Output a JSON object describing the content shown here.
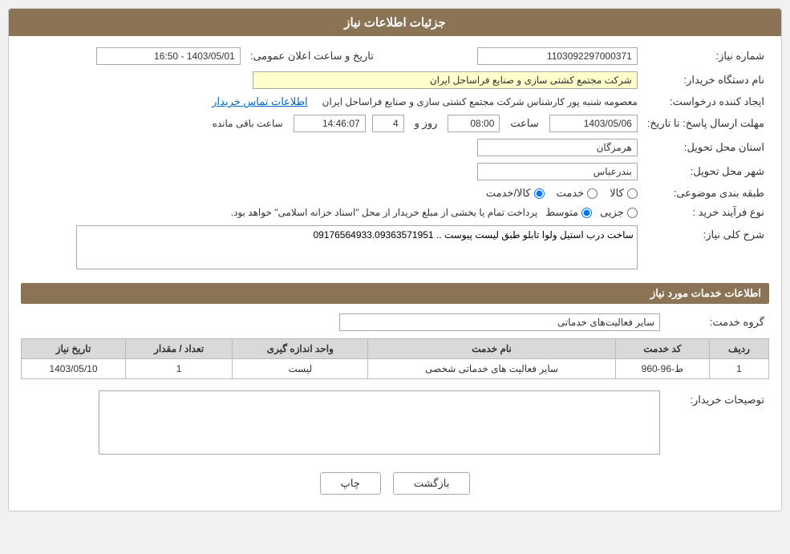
{
  "page": {
    "title": "جزئیات اطلاعات نیاز"
  },
  "sections": {
    "main_section_title": "جزئیات اطلاعات نیاز",
    "services_section_title": "اطلاعات خدمات مورد نیاز"
  },
  "fields": {
    "shomara_niaz_label": "شماره نیاز:",
    "shomara_niaz_value": "1103092297000371",
    "name_dastgah_label": "نام دستگاه خریدار:",
    "name_dastgah_value": "شرکت مجتمع کشتی سازی و صنایع فراساحل ایران",
    "ijad_konande_label": "ایجاد کننده درخواست:",
    "ijad_konande_value": "معصومه شنبه پور کارشناس شرکت مجتمع کشتی سازی و صنایع فراساحل ایران",
    "etelaat_tamas_label": "اطلاعات تماس خریدار",
    "mohlet_ersal_label": "مهلت ارسال پاسخ: تا تاریخ:",
    "date_value": "1403/05/06",
    "saat_label": "ساعت",
    "saat_value": "08:00",
    "rooz_label": "روز و",
    "rooz_value": "4",
    "baqi_mande_label": "ساعت باقی مانده",
    "baqi_mande_value": "14:46:07",
    "ostan_label": "استان محل تحویل:",
    "ostan_value": "هرمزگان",
    "shahr_label": "شهر محل تحویل:",
    "shahr_value": "بندرعباس",
    "tabagheh_label": "طبقه بندی موضوعی:",
    "tabagheh_options": [
      "کالا",
      "خدمت",
      "کالا/خدمت"
    ],
    "tabagheh_selected": "کالا/خدمت",
    "noe_farayand_label": "نوع فرآیند خرید :",
    "noe_farayand_options": [
      "جزیی",
      "متوسط"
    ],
    "noe_farayand_selected": "متوسط",
    "noe_farayand_note": "پرداخت تمام یا بخشی از مبلغ خریدار از محل \"اسناد خزانه اسلامی\" خواهد بود.",
    "sharh_label": "شرح کلی نیاز:",
    "sharh_value": "ساخت درب استیل ولوا تابلو طبق لیست پیوست .. 09176564933.09363571951",
    "tarikh_elan_label": "تاریخ و ساعت اعلان عمومی:",
    "tarikh_elan_value": "1403/05/01 - 16:50",
    "group_khadamat_label": "گروه خدمت:",
    "group_khadamat_value": "سایر فعالیت‌های خدماتی",
    "tosifat_label": "توصیحات خریدار:"
  },
  "table": {
    "headers": [
      "ردیف",
      "کد خدمت",
      "نام خدمت",
      "واحد اندازه گیری",
      "تعداد / مقدار",
      "تاریخ نیاز"
    ],
    "rows": [
      {
        "radif": "1",
        "kod_khadamat": "ط-96-960",
        "name_khadamat": "سایر فعالیت های خدماتی شخصی",
        "vahed": "لیست",
        "tedad": "1",
        "tarikh": "1403/05/10"
      }
    ]
  },
  "buttons": {
    "print_label": "چاپ",
    "back_label": "بازگشت"
  }
}
